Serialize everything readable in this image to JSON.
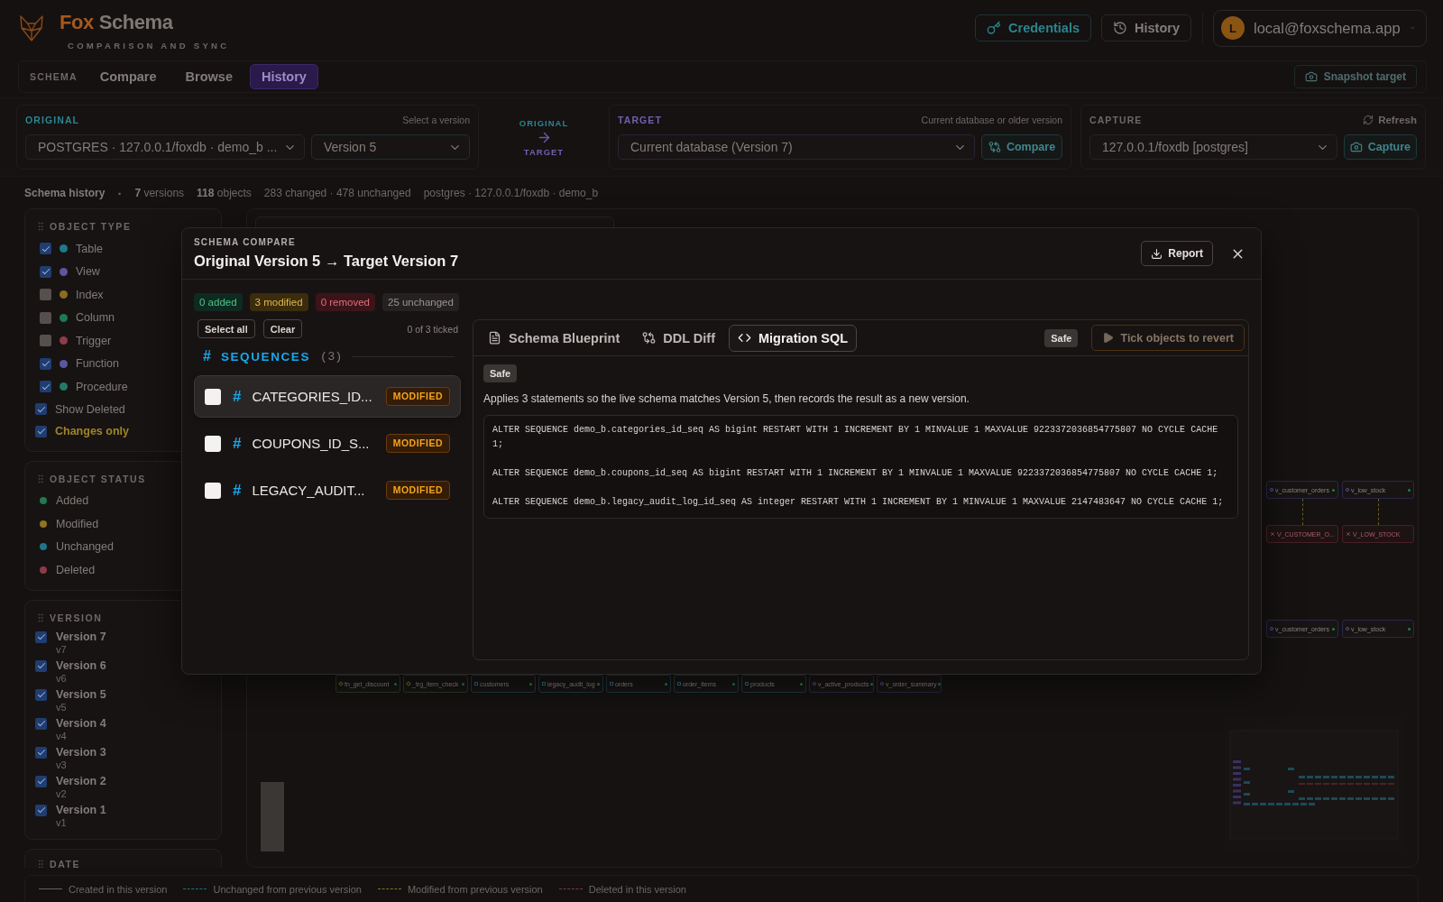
{
  "header": {
    "brand": {
      "accent": "Fox",
      "name": "Schema"
    },
    "tagline": "COMPARISON AND SYNC",
    "actions": [
      {
        "label": "Credentials",
        "kind": "key"
      },
      {
        "label": "History",
        "kind": "history"
      }
    ],
    "user": {
      "initial": "L",
      "email": "local@foxschema.app"
    }
  },
  "nav": {
    "section": "SCHEMA",
    "tabs": [
      {
        "label": "Compare",
        "selected": false
      },
      {
        "label": "Browse",
        "selected": false
      },
      {
        "label": "History",
        "selected": true
      }
    ],
    "snapshot": {
      "label": "Snapshot target",
      "disabled": true
    }
  },
  "original": {
    "label": "ORIGINAL",
    "hint": "Select a version",
    "source": "POSTGRES · 127.0.0.1/foxdb · demo_b ...",
    "version": "Version 5"
  },
  "direction": {
    "from": "ORIGINAL",
    "to": "TARGET"
  },
  "target": {
    "label": "TARGET",
    "hint": "Current database or older version",
    "value": "Current database (Version 7)",
    "button": "Compare"
  },
  "capture": {
    "label": "CAPTURE",
    "refresh": "Refresh",
    "value": "127.0.0.1/foxdb [postgres]",
    "button": "Capture"
  },
  "summary": {
    "title": "Schema history",
    "separator": "·",
    "stats": [
      {
        "value": "7",
        "unit": "versions"
      },
      {
        "value": "118",
        "unit": "objects"
      }
    ],
    "changes": "283 changed · 478 unchanged",
    "source": "postgres · 127.0.0.1/foxdb · demo_b"
  },
  "object_type": {
    "title": "OBJECT TYPE",
    "types": [
      {
        "label": "Table",
        "checked": true,
        "color": "#1d7a8a"
      },
      {
        "label": "View",
        "checked": true,
        "color": "#5f55a0"
      },
      {
        "label": "Index",
        "checked": false,
        "color": "#8a6d1e"
      },
      {
        "label": "Column",
        "checked": false,
        "color": "#1f7a52"
      },
      {
        "label": "Trigger",
        "checked": false,
        "color": "#8e3c4a"
      },
      {
        "label": "Function",
        "checked": true,
        "color": "#5b56a0"
      },
      {
        "label": "Procedure",
        "checked": true,
        "color": "#237a66"
      }
    ],
    "options": [
      {
        "label": "Show Deleted",
        "checked": true,
        "highlighted": false
      },
      {
        "label": "Changes only",
        "checked": true,
        "highlighted": true
      }
    ]
  },
  "object_status": {
    "title": "OBJECT STATUS",
    "items": [
      {
        "label": "Added",
        "color": "#1f7a50"
      },
      {
        "label": "Modified",
        "color": "#8e741e"
      },
      {
        "label": "Unchanged",
        "color": "#1f7688"
      },
      {
        "label": "Deleted",
        "color": "#8e3848"
      }
    ]
  },
  "version": {
    "title": "VERSION",
    "items": [
      {
        "label": "Version 7",
        "tag": "v7",
        "checked": true
      },
      {
        "label": "Version 6",
        "tag": "v6",
        "checked": true
      },
      {
        "label": "Version 5",
        "tag": "v5",
        "checked": true
      },
      {
        "label": "Version 4",
        "tag": "v4",
        "checked": true
      },
      {
        "label": "Version 3",
        "tag": "v3",
        "checked": true
      },
      {
        "label": "Version 2",
        "tag": "v2",
        "checked": true
      },
      {
        "label": "Version 1",
        "tag": "v1",
        "checked": true
      }
    ]
  },
  "date": {
    "title": "DATE"
  },
  "canvas": {
    "bottom_nodes": [
      {
        "name": "fn_get_discount",
        "kind": "routine"
      },
      {
        "name": "_trg_item_check",
        "kind": "routine"
      },
      {
        "name": "customers",
        "kind": "table"
      },
      {
        "name": "legacy_audit_log",
        "kind": "table"
      },
      {
        "name": "orders",
        "kind": "table"
      },
      {
        "name": "order_items",
        "kind": "table"
      },
      {
        "name": "products",
        "kind": "table"
      },
      {
        "name": "v_active_products",
        "kind": "view"
      },
      {
        "name": "v_order_summary",
        "kind": "view"
      }
    ],
    "right_rows": [
      {
        "nodes": [
          {
            "name": "v_customer_orders",
            "kind": "view"
          },
          {
            "name": "v_low_stock",
            "kind": "view"
          }
        ]
      },
      {
        "nodes": [
          {
            "name": "V_CUSTOMER_O...",
            "kind": "deleted"
          },
          {
            "name": "V_LOW_STOCK",
            "kind": "deleted"
          }
        ]
      },
      {
        "nodes": [
          {
            "name": "v_customer_orders",
            "kind": "view"
          },
          {
            "name": "v_low_stock",
            "kind": "view"
          }
        ]
      }
    ]
  },
  "legend": [
    {
      "label": "Created in this version",
      "kind": "solid",
      "color": "#67615f"
    },
    {
      "label": "Unchanged from previous version",
      "kind": "dashed",
      "color": "#21707f"
    },
    {
      "label": "Modified from previous version",
      "kind": "dashed",
      "color": "#7f7126"
    },
    {
      "label": "Deleted in this version",
      "kind": "dashed",
      "color": "#7f3843"
    }
  ],
  "dialog": {
    "eyebrow": "SCHEMA COMPARE",
    "title": "Original Version 5 → Target Version 7",
    "report": "Report",
    "counts": [
      {
        "label": "0 added",
        "kind": "added"
      },
      {
        "label": "3 modified",
        "kind": "modified"
      },
      {
        "label": "0 removed",
        "kind": "removed"
      },
      {
        "label": "25 unchanged",
        "kind": "unchanged"
      }
    ],
    "select_all": "Select all",
    "clear": "Clear",
    "ticked": "0 of 3 ticked",
    "group": {
      "symbol": "#",
      "title": "SEQUENCES",
      "count": "(3)"
    },
    "objects": [
      {
        "symbol": "#",
        "name": "CATEGORIES_ID...",
        "status": "MODIFIED",
        "kind": "modified",
        "checked": false,
        "selected": true
      },
      {
        "symbol": "#",
        "name": "COUPONS_ID_S...",
        "status": "MODIFIED",
        "kind": "modified",
        "checked": false,
        "selected": false
      },
      {
        "symbol": "#",
        "name": "LEGACY_AUDIT...",
        "status": "MODIFIED",
        "kind": "modified",
        "checked": false,
        "selected": false
      }
    ],
    "tabs": [
      {
        "label": "Schema Blueprint",
        "kind": "blueprint",
        "selected": false
      },
      {
        "label": "DDL Diff",
        "kind": "diff",
        "selected": false
      },
      {
        "label": "Migration SQL",
        "kind": "sql",
        "selected": true
      }
    ],
    "safety": "Safe",
    "revert": {
      "label": "Tick objects to revert",
      "disabled": true
    },
    "badge": "Safe",
    "description": "Applies 3 statements so the live schema matches Version 5, then records the result as a new version.",
    "statements": [
      "ALTER SEQUENCE demo_b.categories_id_seq AS bigint RESTART WITH 1 INCREMENT BY 1 MINVALUE 1 MAXVALUE 9223372036854775807 NO CYCLE CACHE 1;",
      "ALTER SEQUENCE demo_b.coupons_id_seq AS bigint RESTART WITH 1 INCREMENT BY 1 MINVALUE 1 MAXVALUE 9223372036854775807 NO CYCLE CACHE 1;",
      "ALTER SEQUENCE demo_b.legacy_audit_log_id_seq AS integer RESTART WITH 1 INCREMENT BY 1 MINVALUE 1 MAXVALUE 2147483647 NO CYCLE CACHE 1;"
    ]
  }
}
